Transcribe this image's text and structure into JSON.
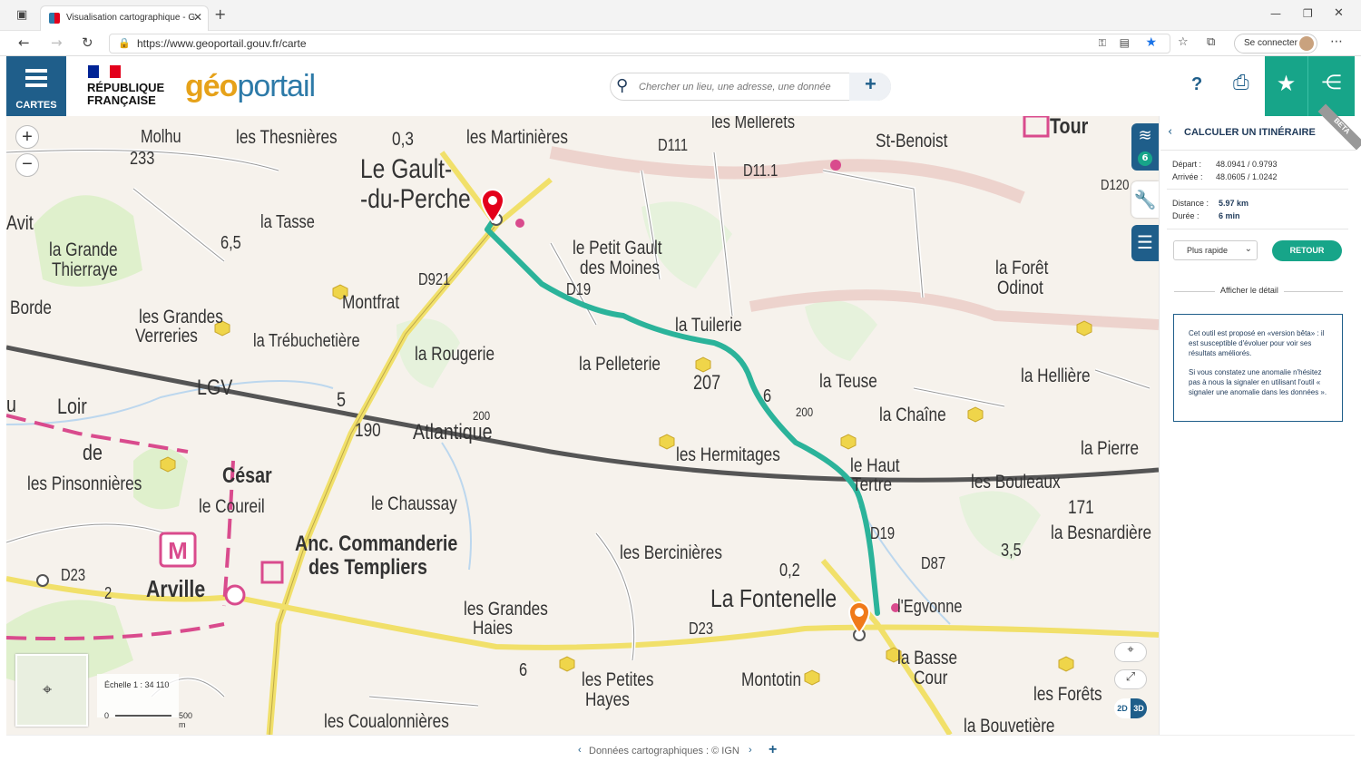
{
  "browser": {
    "tab_title": "Visualisation cartographique - G",
    "url": "https://www.geoportail.gouv.fr/carte",
    "signin_label": "Se connecter"
  },
  "header": {
    "menu_label": "CARTES",
    "republic_line1": "RÉPUBLIQUE",
    "republic_line2": "FRANÇAISE",
    "logo_prefix": "géo",
    "logo_suffix": "portail",
    "search_placeholder": "Chercher un lieu, une adresse, une donnée",
    "help_label": "?"
  },
  "map": {
    "place_labels": [
      "Molhu",
      "233",
      "les Thesnières",
      "0,3",
      "les Martinières",
      "les Mellerets",
      "Tour",
      "St-Benoist",
      "D111",
      "D11.1",
      "D120",
      "Le Gault-",
      "-du-Perche",
      "Avit",
      "la Tasse",
      "6,5",
      "la Grande",
      "Thierraye",
      "le Petit Gault",
      "des Moines",
      "D19",
      "la Forêt",
      "Odinot",
      "Borde",
      "Montfrat",
      "D921",
      "les Grandes",
      "Verreries",
      "la Trébuchetière",
      "la Tuilerie",
      "la Rougerie",
      "la Pelleterie",
      "207",
      "LGV",
      "u",
      "Loir",
      "5",
      "190",
      "Atlantique",
      "la Teuse",
      "6",
      "la Hellière",
      "la Chaîne",
      "de",
      "les Hermitages",
      "le Haut",
      "Tertre",
      "la Pierre",
      "les Pinsonnières",
      "César",
      "le Coureil",
      "le Chaussay",
      "les Bouleaux",
      "171",
      "la Besnardière",
      "Anc. Commanderie",
      "des Templiers",
      "les Bercinières",
      "D19",
      "D87",
      "3,5",
      "Arville",
      "D23",
      "2",
      "0,2",
      "La Fontenelle",
      "l'Egvonne",
      "les Grandes",
      "Haies",
      "D23",
      "6",
      "les Petites",
      "Hayes",
      "Montotin",
      "la Basse",
      "Cour",
      "les Forêts",
      "les Coualonnières",
      "la Bouvetière",
      "200",
      "200"
    ],
    "zoom_in": "+",
    "zoom_out": "−",
    "scale_label": "Échelle 1 : 34 110",
    "scale_min": "0",
    "scale_max": "500 m",
    "mode_2d": "2D",
    "mode_3d": "3D",
    "layers_badge": "6"
  },
  "itinerary": {
    "title": "CALCULER UN ITINÉRAIRE",
    "beta": "BETA",
    "depart_label": "Départ :",
    "depart_value": "48.0941 / 0.9793",
    "arrivee_label": "Arrivée :",
    "arrivee_value": "48.0605 / 1.0242",
    "distance_label": "Distance :",
    "distance_value": "5.97 km",
    "duree_label": "Durée :",
    "duree_value": "6 min",
    "mode_selected": "Plus rapide",
    "back_button": "RETOUR",
    "detail_link": "Afficher le détail",
    "notice_p1": "Cet outil est proposé en «version bêta» : il est susceptible d'évoluer pour voir ses résultats améliorés.",
    "notice_p2": "Si vous constatez une anomalie n'hésitez pas à nous la signaler en utilisant l'outil « signaler une anomalie dans les données »."
  },
  "footer": {
    "credits": "Données cartographiques : © IGN"
  },
  "colors": {
    "primary": "#1f5e8a",
    "accent": "#17a589",
    "route": "#2bb39a",
    "start_marker": "#e3001b",
    "end_marker": "#f07a1a"
  }
}
